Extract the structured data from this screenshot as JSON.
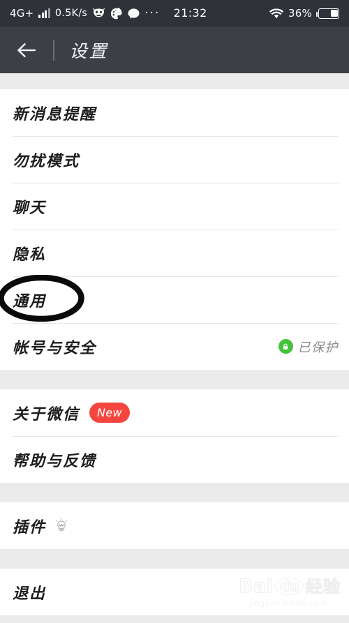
{
  "status_bar": {
    "network_label": "4G+",
    "signal_icon": "signal-bars-icon",
    "speed": "0.5K/s",
    "app_icons": [
      "monster-app-icon",
      "palette-app-icon",
      "chat-bubble-icon"
    ],
    "overflow": "···",
    "clock": "21:32",
    "wifi_icon": "wifi-icon",
    "battery_percent": "36%",
    "battery_level": 36,
    "bar_bg": "#2f3239"
  },
  "header": {
    "back_icon": "back-arrow-icon",
    "title": "设置",
    "bg": "#3c3f46"
  },
  "groups": [
    {
      "id": "notifications-group",
      "rows": [
        {
          "id": "new-message-alerts",
          "label": "新消息提醒"
        },
        {
          "id": "do-not-disturb",
          "label": "勿扰模式"
        },
        {
          "id": "chat",
          "label": "聊天"
        },
        {
          "id": "privacy",
          "label": "隐私"
        },
        {
          "id": "general",
          "label": "通用"
        },
        {
          "id": "account-and-security",
          "label": "帐号与安全",
          "value": "已保护",
          "value_icon": "green-lock-icon",
          "value_icon_color": "#44c23b"
        }
      ]
    },
    {
      "id": "about-group",
      "rows": [
        {
          "id": "about-wechat",
          "label": "关于微信",
          "badge": "New",
          "badge_color": "#f4463f"
        },
        {
          "id": "help-and-feedback",
          "label": "帮助与反馈"
        }
      ]
    },
    {
      "id": "plugins-group",
      "rows": [
        {
          "id": "plugins",
          "label": "插件",
          "trailing_icon": "lightbulb-icon"
        }
      ]
    },
    {
      "id": "logout-group",
      "rows": [
        {
          "id": "logout",
          "label": "退出"
        }
      ]
    }
  ],
  "annotation": {
    "type": "hand-drawn-ellipse",
    "targets_row": "general",
    "color": "#0a0a0a"
  },
  "watermark": {
    "bai": "Bai",
    "du": "du",
    "jingyan": "经验",
    "url": "jingyan.baidu.com"
  }
}
